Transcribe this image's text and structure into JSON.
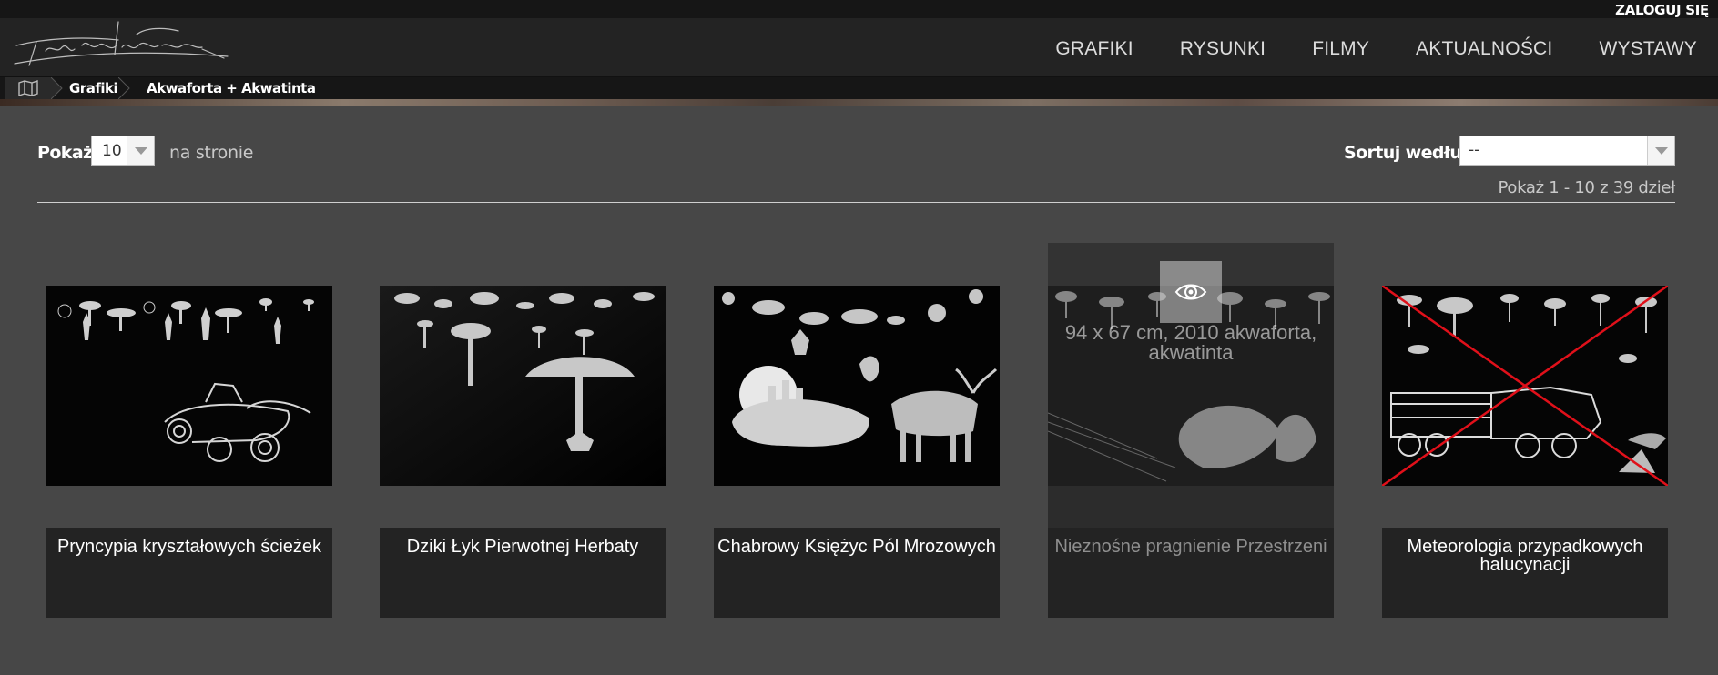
{
  "topbar": {
    "login_label": "ZALOGUJ SIĘ"
  },
  "nav": {
    "items": [
      "GRAFIKI",
      "RYSUNKI",
      "FILMY",
      "AKTUALNOŚCI",
      "WYSTAWY"
    ]
  },
  "breadcrumb": {
    "items": [
      "Grafiki",
      "Akwaforta + Akwatinta"
    ]
  },
  "controls": {
    "show_label": "Pokaż",
    "per_page_value": "10",
    "per_page_suffix": "na stronie",
    "sort_label": "Sortuj według",
    "sort_value": "--",
    "count_text": "Pokaż 1 - 10 z 39 dzieł"
  },
  "works": [
    {
      "title": "Pryncypia kryształowych ścieżek"
    },
    {
      "title": "Dziki Łyk Pierwotnej Herbaty"
    },
    {
      "title": "Chabrowy Księżyc Pól Mrozowych"
    },
    {
      "title": "Nieznośne pragnienie Przestrzeni",
      "hover_info": "94 x 67 cm, 2010 akwaforta, akwatinta"
    },
    {
      "title": "Meteorologia przypadkowych halucynacji",
      "crossed_out": true
    }
  ],
  "colors": {
    "background": "#474747",
    "header": "#232323",
    "cross": "#e0101a"
  }
}
